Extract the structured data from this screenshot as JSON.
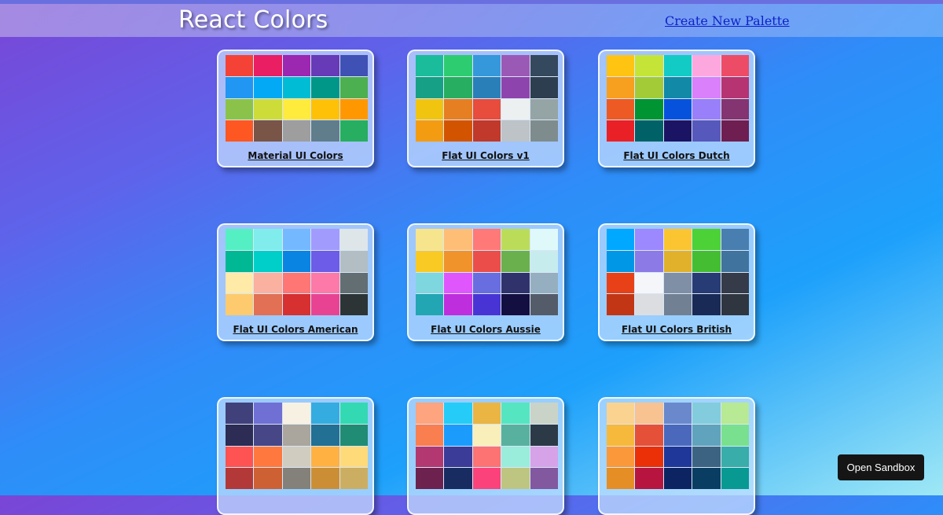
{
  "header": {
    "brand": "React Colors",
    "new_palette_label": "Create New Palette"
  },
  "palettes": [
    {
      "title": "Material UI Colors",
      "colors": [
        "#f44336",
        "#e91e63",
        "#9c27b0",
        "#673ab7",
        "#3f51b5",
        "#2196f3",
        "#03a9f4",
        "#00bcd4",
        "#009688",
        "#4caf50",
        "#8bc34a",
        "#cddc39",
        "#ffeb3b",
        "#ffc107",
        "#ff9800",
        "#ff5722",
        "#795548",
        "#9e9e9e",
        "#607d8b",
        "#27ae60"
      ]
    },
    {
      "title": "Flat UI Colors v1",
      "colors": [
        "#1abc9c",
        "#2ecc71",
        "#3498db",
        "#9b59b6",
        "#34495e",
        "#16a085",
        "#27ae60",
        "#2980b9",
        "#8e44ad",
        "#2c3e50",
        "#f1c40f",
        "#e67e22",
        "#e74c3c",
        "#ecf0f1",
        "#95a5a6",
        "#f39c12",
        "#d35400",
        "#c0392b",
        "#bdc3c7",
        "#7f8c8d"
      ]
    },
    {
      "title": "Flat UI Colors Dutch",
      "colors": [
        "#ffc312",
        "#c4e538",
        "#12cbc4",
        "#fda7df",
        "#ed4c67",
        "#f79f1f",
        "#a3cb38",
        "#1289a7",
        "#d980fa",
        "#b53471",
        "#ee5a24",
        "#009432",
        "#0652dd",
        "#9980fa",
        "#833471",
        "#ea2027",
        "#006266",
        "#1b1464",
        "#5758bb",
        "#6f1e51"
      ]
    },
    {
      "title": "Flat UI Colors American",
      "colors": [
        "#55efc4",
        "#81ecec",
        "#74b9ff",
        "#a29bfe",
        "#dfe6e9",
        "#00b894",
        "#00cec9",
        "#0984e3",
        "#6c5ce7",
        "#b2bec3",
        "#ffeaa7",
        "#fab1a0",
        "#ff7675",
        "#fd79a8",
        "#636e72",
        "#fdcb6e",
        "#e17055",
        "#d63031",
        "#e84393",
        "#2d3436"
      ]
    },
    {
      "title": "Flat UI Colors Aussie",
      "colors": [
        "#f6e58d",
        "#ffbe76",
        "#ff7979",
        "#badc58",
        "#dff9fb",
        "#f9ca24",
        "#f0932b",
        "#eb4d4b",
        "#6ab04c",
        "#c7ecee",
        "#7ed6df",
        "#e056fd",
        "#686de0",
        "#30336b",
        "#95afc0",
        "#22a6b3",
        "#be2edd",
        "#4834d4",
        "#130f40",
        "#535c68"
      ]
    },
    {
      "title": "Flat UI Colors British",
      "colors": [
        "#00a8ff",
        "#9c88ff",
        "#fbc531",
        "#4cd137",
        "#487eb0",
        "#0097e6",
        "#8c7ae6",
        "#e1b12c",
        "#44bd32",
        "#40739e",
        "#e84118",
        "#f5f6fa",
        "#7f8fa6",
        "#273c75",
        "#353b48",
        "#c23616",
        "#dcdde1",
        "#718093",
        "#192a56",
        "#2f3640"
      ]
    },
    {
      "title": "",
      "colors": [
        "#40407a",
        "#706fd3",
        "#f7f1e3",
        "#34ace0",
        "#33d9b2",
        "#2c2c54",
        "#474787",
        "#aaa69d",
        "#227093",
        "#218c74",
        "#ff5252",
        "#ff793f",
        "#d1ccc0",
        "#ffb142",
        "#ffda79",
        "#b33939",
        "#cd6133",
        "#84817a",
        "#cc8e35",
        "#ccae62"
      ]
    },
    {
      "title": "",
      "colors": [
        "#fea47f",
        "#25ccf7",
        "#eab543",
        "#55e6c1",
        "#cad3c8",
        "#f97f51",
        "#1b9cfc",
        "#f8efba",
        "#58b19f",
        "#2c3a47",
        "#b33771",
        "#3b3b98",
        "#fd7272",
        "#9aecdb",
        "#d6a2e8",
        "#6d214f",
        "#182c61",
        "#fc427b",
        "#bdc581",
        "#82589f"
      ]
    },
    {
      "title": "",
      "colors": [
        "#fad390",
        "#f8c291",
        "#6a89cc",
        "#82ccdd",
        "#b8e994",
        "#f6b93b",
        "#e55039",
        "#4a69bd",
        "#60a3bc",
        "#78e08f",
        "#fa983a",
        "#eb2f06",
        "#1e3799",
        "#3c6382",
        "#38ada9",
        "#e58e26",
        "#b71540",
        "#0c2461",
        "#0a3d62",
        "#079992"
      ]
    }
  ],
  "sandbox_label": "Open Sandbox"
}
